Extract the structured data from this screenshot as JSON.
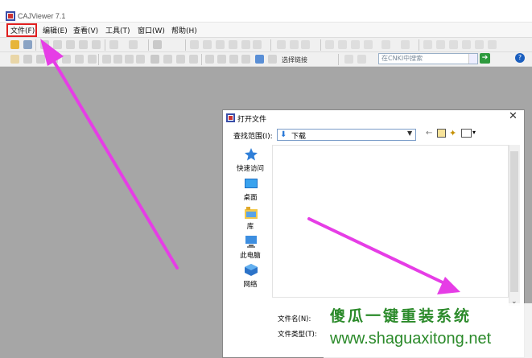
{
  "window": {
    "title": "CAJViewer 7.1",
    "app_icon": "cajviewer-logo-icon"
  },
  "menubar": {
    "items": [
      {
        "label": "文件(F)"
      },
      {
        "label": "编辑(E)"
      },
      {
        "label": "查看(V)"
      },
      {
        "label": "工具(T)"
      },
      {
        "label": "窗口(W)"
      },
      {
        "label": "帮助(H)"
      }
    ]
  },
  "toolbar2": {
    "link_label": "选择链接",
    "search_placeholder": "在CNKI中搜索",
    "go_icon": "go-arrow-icon",
    "help_icon": "help-icon"
  },
  "dialog": {
    "title": "打开文件",
    "look_in_label": "查找范围(I):",
    "look_in_value": "下载",
    "places": [
      {
        "label": "快速访问",
        "icon": "quick-access-star-icon"
      },
      {
        "label": "桌面",
        "icon": "desktop-icon"
      },
      {
        "label": "库",
        "icon": "library-icon"
      },
      {
        "label": "此电脑",
        "icon": "this-pc-icon"
      },
      {
        "label": "网络",
        "icon": "network-icon"
      }
    ],
    "file_name_label": "文件名(N):",
    "file_type_label": "文件类型(T):"
  },
  "watermark": {
    "line1": "傻瓜一键重装系统",
    "line2": "www.shaguaxitong.net"
  },
  "colors": {
    "highlight_box": "#e02020",
    "arrow": "#e63de6",
    "workspace": "#a6a6a6",
    "watermark": "#2b8a2a"
  }
}
